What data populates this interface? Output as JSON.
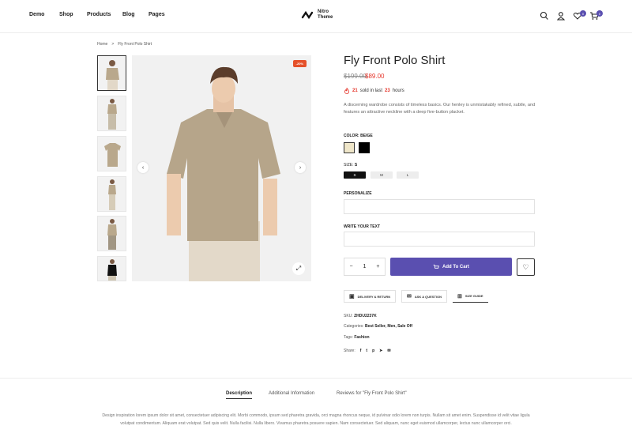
{
  "nav": [
    "Demo",
    "Shop",
    "Products",
    "Blog",
    "Pages"
  ],
  "logo": {
    "line1": "Nitro",
    "line2": "Theme"
  },
  "header": {
    "wishlist_count": "0",
    "cart_count": "0"
  },
  "breadcrumb": [
    "Home",
    "Fly Front Polo Shirt"
  ],
  "breadcrumb_sep": ">",
  "product": {
    "discount": "-20%",
    "title": "Fly Front Polo Shirt",
    "price_old": "$199.00",
    "price_new": "$89.00",
    "sold_count": "21",
    "sold_text1": "sold in last",
    "sold_hours": "23",
    "sold_text2": "hours",
    "description": "A discerning wardrobe consists of timeless basics. Our henley is unmistakably refined, subtle, and features an attractive neckline with a deep five-button placket.",
    "color_label": "COLOR:",
    "color_value": "BEIGE",
    "colors": [
      "#efe6c9",
      "#000000"
    ],
    "size_label": "SIZE:",
    "size_value": "S",
    "sizes": [
      "S",
      "M",
      "L"
    ],
    "personalize_label": "PERSONALIZE",
    "write_label": "WRITE YOUR TEXT",
    "quantity": "1",
    "add_to_cart": "Add To Cart",
    "actions": [
      "DELIVERY & RETURN",
      "ASK A QUESTION",
      "SIZE GUIDE"
    ],
    "sku_label": "SKU:",
    "sku": "ZHDU2237K",
    "categories_label": "Categories:",
    "categories": "Best Seller, Men, Sale Off",
    "tags_label": "Tags:",
    "tags": "Fashion",
    "share_label": "Share:"
  },
  "tabs": [
    "Description",
    "Additional Information",
    "Reviews for \"Fly Front Polo Shirt\""
  ],
  "description_body": "Design inspiration lorem ipsum dolor sit amet, consectetuer adipiscing elit. Morbi commodo, ipsum sed pharetra gravida, orci magna rhoncus neque, id pulvinar odio lorem non turpis. Nullam sit amet enim. Suspendisse id velit vitae ligula volutpat condimentum. Aliquam erat volutpat. Sed quis velit. Nulla facilisi. Nulla libero. Vivamus pharetra posuere sapien. Nam consectetuer. Sed aliquam, nunc eget euismod ullamcorper, lectus nunc ullamcorper orci.",
  "colors_ui": {
    "accent": "#5a4fb0",
    "sale": "#e5352a"
  }
}
